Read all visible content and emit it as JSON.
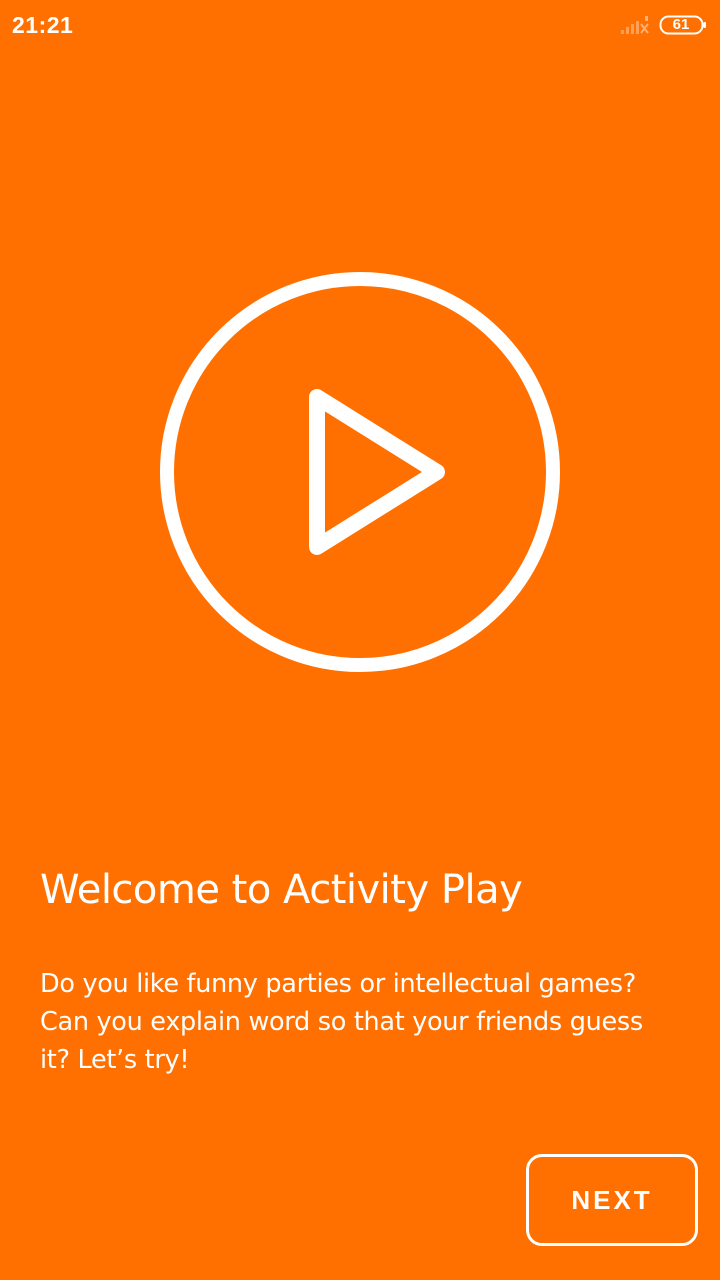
{
  "status_bar": {
    "time": "21:21",
    "battery": "61",
    "signal_icon": "signal-weak-icon",
    "battery_icon": "battery-icon"
  },
  "hero": {
    "icon": "play-circle-icon"
  },
  "intro": {
    "title": "Welcome to Activity Play",
    "description": "Do you like funny parties or intellectual games? Can you explain word so that your friends guess it? Let’s try!"
  },
  "actions": {
    "next_label": "NEXT"
  },
  "colors": {
    "background": "#FF7000",
    "foreground": "#FFFFFF"
  }
}
